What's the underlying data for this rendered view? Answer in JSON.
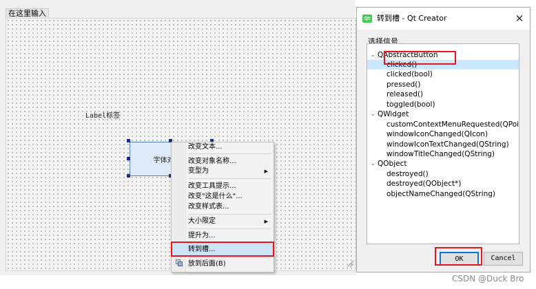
{
  "designer": {
    "form_tab": "在这里输入",
    "label_text": "Label标签",
    "button_text": "字体对话框"
  },
  "context_menu": {
    "items": [
      {
        "label": "改变文本..."
      },
      {
        "label": "改变对象名称..."
      },
      {
        "label": "变型为",
        "arrow": "▶"
      },
      {
        "label": "改变工具提示..."
      },
      {
        "label": "改变\"这是什么\"..."
      },
      {
        "label": "改变样式表..."
      },
      {
        "label": "大小限定",
        "arrow": "▶"
      },
      {
        "label": "提升为..."
      },
      {
        "label": "转到槽..."
      },
      {
        "label": "放到后面(B)"
      }
    ]
  },
  "dialog": {
    "app_icon_text": "Qt",
    "title": "转到槽 - Qt Creator",
    "close_glyph": "✕",
    "section_label": "选择信号",
    "tree": [
      {
        "text": "QAbstractButton",
        "group": true,
        "toggle": "⌄"
      },
      {
        "text": "clicked()",
        "selected": true
      },
      {
        "text": "clicked(bool)"
      },
      {
        "text": "pressed()"
      },
      {
        "text": "released()"
      },
      {
        "text": "toggled(bool)"
      },
      {
        "text": "QWidget",
        "group": true,
        "toggle": "⌄"
      },
      {
        "text": "customContextMenuRequested(QPoint)"
      },
      {
        "text": "windowIconChanged(QIcon)"
      },
      {
        "text": "windowIconTextChanged(QString)"
      },
      {
        "text": "windowTitleChanged(QString)"
      },
      {
        "text": "QObject",
        "group": true,
        "toggle": "⌄"
      },
      {
        "text": "destroyed()"
      },
      {
        "text": "destroyed(QObject*)"
      },
      {
        "text": "objectNameChanged(QString)"
      }
    ],
    "ok_label": "OK",
    "cancel_label": "Cancel"
  },
  "watermark": "CSDN @Duck Bro",
  "colors": {
    "annotation_red": "#e8141c",
    "selection_blue": "#cce8ff",
    "focus_blue": "#0078d7",
    "qt_green": "#41cd52"
  }
}
